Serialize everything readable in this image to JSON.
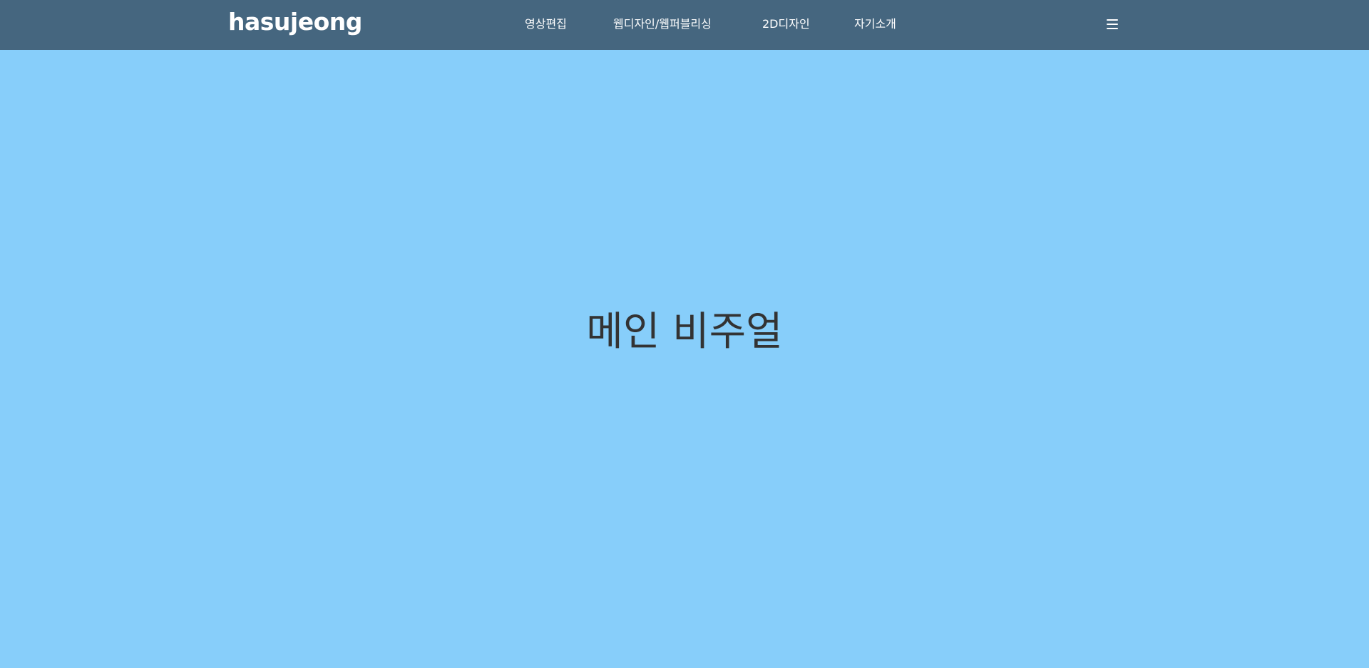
{
  "header": {
    "logo": "hasujeong",
    "nav": [
      {
        "label": "영상편집"
      },
      {
        "label": "웹디자인/웹퍼블리싱"
      },
      {
        "label": "2D디자인"
      },
      {
        "label": "자기소개"
      }
    ],
    "menu_icon": "hamburger-icon",
    "background_color": "#45667f"
  },
  "main_visual": {
    "title": "메인 비주얼",
    "background_color": "#87cefa"
  }
}
